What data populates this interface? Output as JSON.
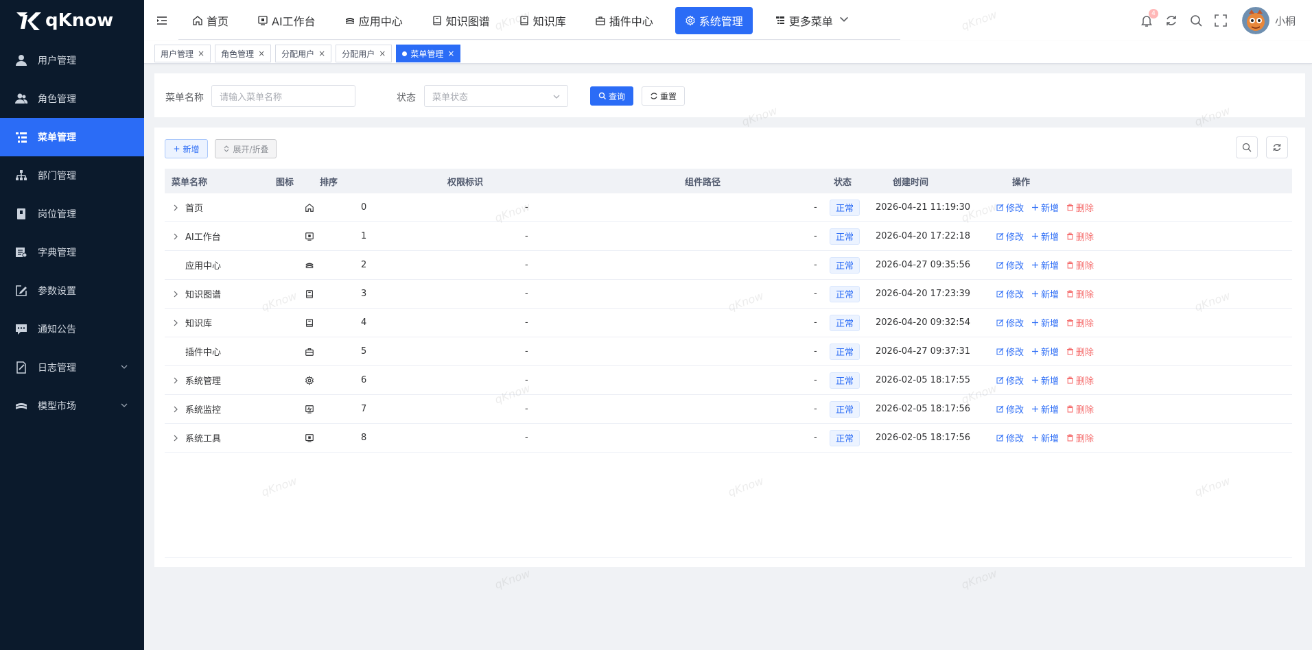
{
  "brand": {
    "name": "qKnow"
  },
  "sidebar": {
    "items": [
      {
        "label": "用户管理",
        "icon": "user-icon"
      },
      {
        "label": "角色管理",
        "icon": "role-icon"
      },
      {
        "label": "菜单管理",
        "icon": "menu-tree-icon",
        "active": true
      },
      {
        "label": "部门管理",
        "icon": "org-icon"
      },
      {
        "label": "岗位管理",
        "icon": "post-icon"
      },
      {
        "label": "字典管理",
        "icon": "dict-icon"
      },
      {
        "label": "参数设置",
        "icon": "edit-icon"
      },
      {
        "label": "通知公告",
        "icon": "message-icon"
      },
      {
        "label": "日志管理",
        "icon": "log-icon",
        "expandable": true
      },
      {
        "label": "模型市场",
        "icon": "market-icon",
        "expandable": true
      }
    ]
  },
  "topnav": {
    "items": [
      {
        "label": "首页",
        "icon": "home-icon"
      },
      {
        "label": "AI工作台",
        "icon": "monitor-icon"
      },
      {
        "label": "应用中心",
        "icon": "stack-icon"
      },
      {
        "label": "知识图谱",
        "icon": "book-icon"
      },
      {
        "label": "知识库",
        "icon": "book-icon"
      },
      {
        "label": "插件中心",
        "icon": "briefcase-icon"
      },
      {
        "label": "系统管理",
        "icon": "gear-icon",
        "active": true
      },
      {
        "label": "更多菜单",
        "icon": "tree-icon",
        "dropdown": true
      }
    ],
    "notification_count": "4",
    "username": "小桐"
  },
  "tags": [
    {
      "label": "用户管理"
    },
    {
      "label": "角色管理"
    },
    {
      "label": "分配用户"
    },
    {
      "label": "分配用户"
    },
    {
      "label": "菜单管理",
      "active": true
    }
  ],
  "search": {
    "menu_name_label": "菜单名称",
    "menu_name_placeholder": "请输入菜单名称",
    "status_label": "状态",
    "status_placeholder": "菜单状态",
    "query_button": "查询",
    "reset_button": "重置"
  },
  "toolbar": {
    "add_button": "新增",
    "expand_button": "展开/折叠"
  },
  "table": {
    "columns": [
      "菜单名称",
      "图标",
      "排序",
      "权限标识",
      "组件路径",
      "状态",
      "创建时间",
      "操作"
    ],
    "rows": [
      {
        "name": "首页",
        "icon": "home-icon",
        "order": "0",
        "perm": "-",
        "path": "-",
        "status": "正常",
        "created": "2026-04-21 11:19:30",
        "expandable": true
      },
      {
        "name": "AI工作台",
        "icon": "monitor-icon",
        "order": "1",
        "perm": "-",
        "path": "-",
        "status": "正常",
        "created": "2026-04-20 17:22:18",
        "expandable": true
      },
      {
        "name": "应用中心",
        "icon": "stack-icon",
        "order": "2",
        "perm": "-",
        "path": "-",
        "status": "正常",
        "created": "2026-04-27 09:35:56",
        "expandable": false
      },
      {
        "name": "知识图谱",
        "icon": "book-icon",
        "order": "3",
        "perm": "-",
        "path": "-",
        "status": "正常",
        "created": "2026-04-20 17:23:39",
        "expandable": true
      },
      {
        "name": "知识库",
        "icon": "book-icon",
        "order": "4",
        "perm": "-",
        "path": "-",
        "status": "正常",
        "created": "2026-04-20 09:32:54",
        "expandable": true
      },
      {
        "name": "插件中心",
        "icon": "briefcase-icon",
        "order": "5",
        "perm": "-",
        "path": "-",
        "status": "正常",
        "created": "2026-04-27 09:37:31",
        "expandable": false
      },
      {
        "name": "系统管理",
        "icon": "gear-icon",
        "order": "6",
        "perm": "-",
        "path": "-",
        "status": "正常",
        "created": "2026-02-05 18:17:55",
        "expandable": true
      },
      {
        "name": "系统监控",
        "icon": "monitor-chart-icon",
        "order": "7",
        "perm": "-",
        "path": "-",
        "status": "正常",
        "created": "2026-02-05 18:17:56",
        "expandable": true
      },
      {
        "name": "系统工具",
        "icon": "monitor-icon",
        "order": "8",
        "perm": "-",
        "path": "-",
        "status": "正常",
        "created": "2026-02-05 18:17:56",
        "expandable": true
      }
    ],
    "actions": {
      "edit": "修改",
      "add": "新增",
      "delete": "删除"
    }
  },
  "watermark": "qKnow",
  "colors": {
    "primary": "#2b6cf6",
    "sidebar_bg": "#0b1a2c",
    "danger": "#f56c6c"
  }
}
